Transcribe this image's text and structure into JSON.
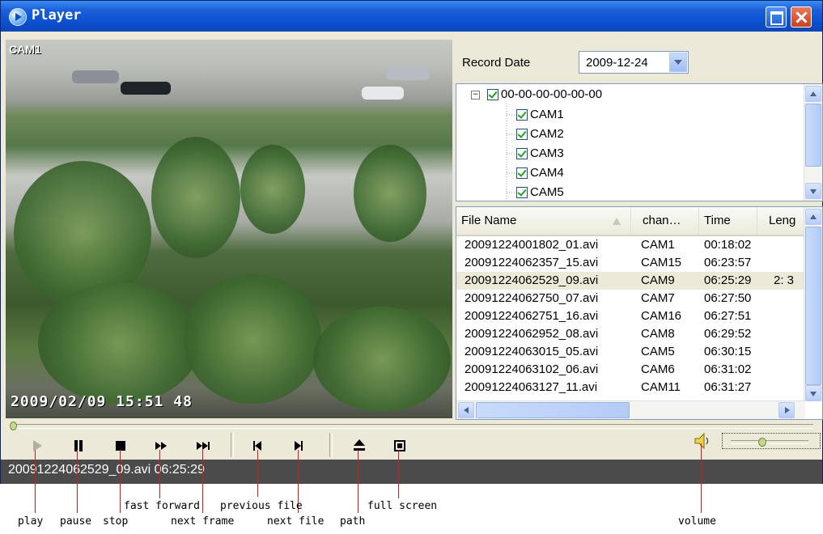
{
  "window": {
    "title": "Player"
  },
  "video": {
    "camera_label": "CAM1",
    "osd_timestamp": "2009/02/09 15:51 48"
  },
  "record_date": {
    "label": "Record Date",
    "value": "2009-12-24"
  },
  "device_tree": {
    "root": "00-00-00-00-00-00",
    "root_expander": "−",
    "channels": [
      "CAM1",
      "CAM2",
      "CAM3",
      "CAM4",
      "CAM5"
    ]
  },
  "file_list": {
    "columns": [
      "File Name",
      "chan…",
      "Time",
      "Leng"
    ],
    "rows": [
      {
        "name": "20091224001802_01.avi",
        "channel": "CAM1",
        "time": "00:18:02",
        "length": ""
      },
      {
        "name": "20091224062357_15.avi",
        "channel": "CAM15",
        "time": "06:23:57",
        "length": ""
      },
      {
        "name": "20091224062529_09.avi",
        "channel": "CAM9",
        "time": "06:25:29",
        "length": "2: 3"
      },
      {
        "name": "20091224062750_07.avi",
        "channel": "CAM7",
        "time": "06:27:50",
        "length": ""
      },
      {
        "name": "20091224062751_16.avi",
        "channel": "CAM16",
        "time": "06:27:51",
        "length": ""
      },
      {
        "name": "20091224062952_08.avi",
        "channel": "CAM8",
        "time": "06:29:52",
        "length": ""
      },
      {
        "name": "20091224063015_05.avi",
        "channel": "CAM5",
        "time": "06:30:15",
        "length": ""
      },
      {
        "name": "20091224063102_06.avi",
        "channel": "CAM6",
        "time": "06:31:02",
        "length": ""
      },
      {
        "name": "20091224063127_11.avi",
        "channel": "CAM11",
        "time": "06:31:27",
        "length": ""
      }
    ],
    "selected_index": 2
  },
  "status": {
    "text": "20091224062529_09.avi   06:25:29"
  },
  "controls": [
    "play",
    "pause",
    "stop",
    "fast-forward",
    "next-frame",
    "previous-file",
    "next-file",
    "path",
    "full-screen"
  ],
  "seek_progress": 0.0,
  "volume_level": 0.4,
  "annotations": {
    "play": "play",
    "pause": "pause",
    "stop": "stop",
    "fast_forward": "fast forward",
    "next_frame": "next frame",
    "previous_file": "previous file",
    "next_file": "next file",
    "path": "path",
    "full_screen": "full screen",
    "volume": "volume"
  },
  "colors": {
    "titlebar": "#0c4fd0",
    "annotation_line": "#d41b1b",
    "check": "#21a121",
    "status_bg": "#4b4b4b"
  }
}
